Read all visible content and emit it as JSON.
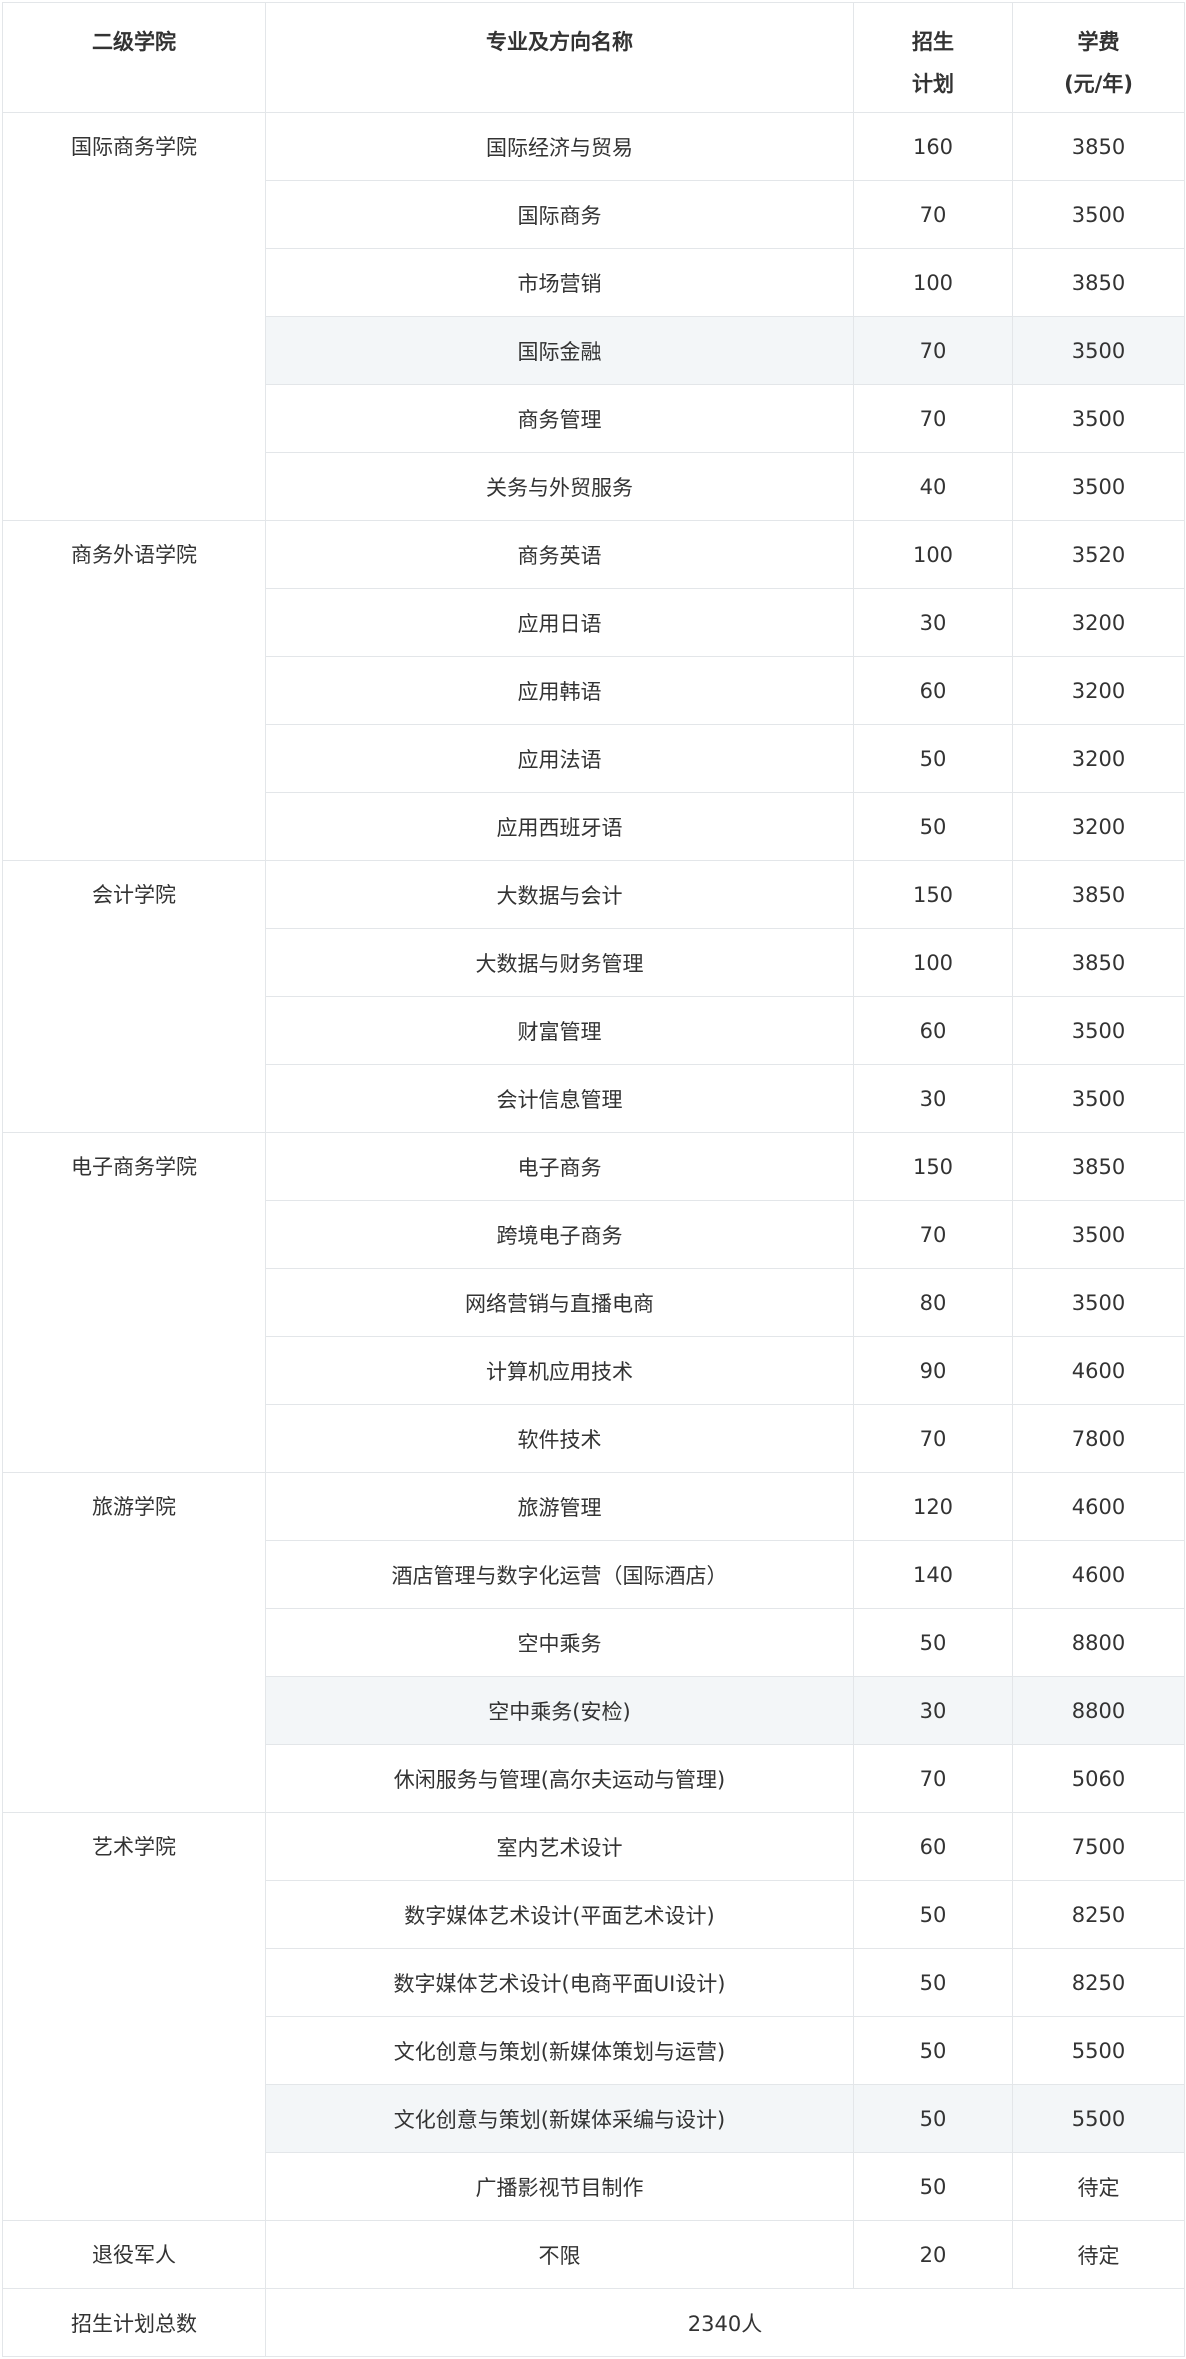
{
  "headers": {
    "college": "二级学院",
    "major": "专业及方向名称",
    "plan_line1": "招生",
    "plan_line2": "计划",
    "fee_line1": "学费",
    "fee_line2": "(元/年)"
  },
  "rows": [
    {
      "college": "国际商务学院",
      "major": "国际经济与贸易",
      "plan": "160",
      "fee": "3850"
    },
    {
      "major": "国际商务",
      "plan": "70",
      "fee": "3500"
    },
    {
      "major": "市场营销",
      "plan": "100",
      "fee": "3850"
    },
    {
      "major": "国际金融",
      "plan": "70",
      "fee": "3500"
    },
    {
      "major": "商务管理",
      "plan": "70",
      "fee": "3500"
    },
    {
      "major": "关务与外贸服务",
      "plan": "40",
      "fee": "3500"
    },
    {
      "college": "商务外语学院",
      "major": "商务英语",
      "plan": "100",
      "fee": "3520"
    },
    {
      "major": "应用日语",
      "plan": "30",
      "fee": "3200"
    },
    {
      "major": "应用韩语",
      "plan": "60",
      "fee": "3200"
    },
    {
      "major": "应用法语",
      "plan": "50",
      "fee": "3200"
    },
    {
      "major": "应用西班牙语",
      "plan": "50",
      "fee": "3200"
    },
    {
      "college": "会计学院",
      "major": "大数据与会计",
      "plan": "150",
      "fee": "3850"
    },
    {
      "major": "大数据与财务管理",
      "plan": "100",
      "fee": "3850"
    },
    {
      "major": "财富管理",
      "plan": "60",
      "fee": "3500"
    },
    {
      "major": "会计信息管理",
      "plan": "30",
      "fee": "3500"
    },
    {
      "college": "电子商务学院",
      "major": "电子商务",
      "plan": "150",
      "fee": "3850"
    },
    {
      "major": "跨境电子商务",
      "plan": "70",
      "fee": "3500"
    },
    {
      "major": "网络营销与直播电商",
      "plan": "80",
      "fee": "3500"
    },
    {
      "major": "计算机应用技术",
      "plan": "90",
      "fee": "4600"
    },
    {
      "major": "软件技术",
      "plan": "70",
      "fee": "7800"
    },
    {
      "college": "旅游学院",
      "major": "旅游管理",
      "plan": "120",
      "fee": "4600"
    },
    {
      "major": "酒店管理与数字化运营（国际酒店）",
      "plan": "140",
      "fee": "4600"
    },
    {
      "major": "空中乘务",
      "plan": "50",
      "fee": "8800"
    },
    {
      "major": "空中乘务(安检)",
      "plan": "30",
      "fee": "8800"
    },
    {
      "major": "休闲服务与管理(高尔夫运动与管理)",
      "plan": "70",
      "fee": "5060"
    },
    {
      "college": "艺术学院",
      "major": "室内艺术设计",
      "plan": "60",
      "fee": "7500"
    },
    {
      "major": "数字媒体艺术设计(平面艺术设计)",
      "plan": "50",
      "fee": "8250"
    },
    {
      "major": "数字媒体艺术设计(电商平面UI设计)",
      "plan": "50",
      "fee": "8250"
    },
    {
      "major": "文化创意与策划(新媒体策划与运营)",
      "plan": "50",
      "fee": "5500"
    },
    {
      "major": "文化创意与策划(新媒体采编与设计)",
      "plan": "50",
      "fee": "5500"
    },
    {
      "major": "广播影视节目制作",
      "plan": "50",
      "fee": "待定"
    },
    {
      "college": "退役军人",
      "major": "不限",
      "plan": "20",
      "fee": "待定"
    }
  ],
  "total": {
    "label": "招生计划总数",
    "value": "2340人"
  }
}
